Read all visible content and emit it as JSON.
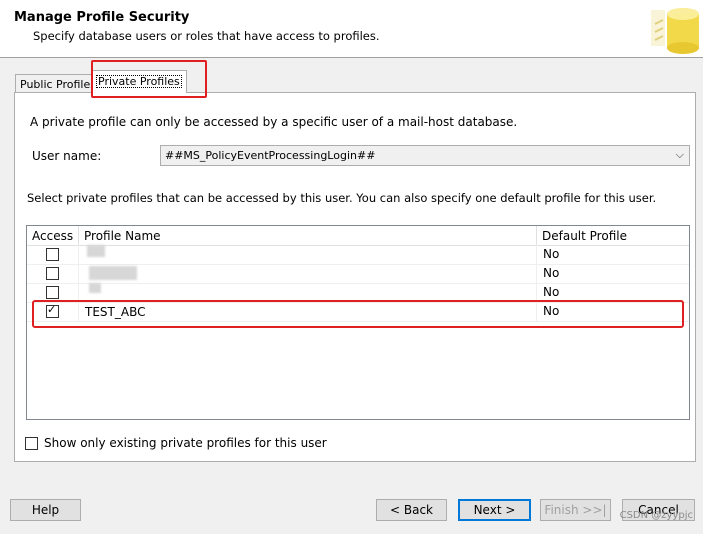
{
  "header": {
    "title": "Manage Profile Security",
    "subtitle": "Specify database users or roles that have access to profiles."
  },
  "tabs": [
    {
      "label": "Public Profiles",
      "selected": false
    },
    {
      "label": "Private Profiles",
      "selected": true
    }
  ],
  "panel": {
    "info_text": "A private profile can only be accessed by a specific user of a mail-host database.",
    "user_name_label": "User name:",
    "user_name_value": "##MS_PolicyEventProcessingLogin##",
    "select_text": "Select private profiles that can be accessed by this user. You can also specify one default profile for this user.",
    "grid": {
      "columns": [
        "Access",
        "Profile Name",
        "Default Profile"
      ],
      "rows": [
        {
          "access": false,
          "profile_name": "",
          "default_profile": "No"
        },
        {
          "access": false,
          "profile_name": "",
          "default_profile": "No"
        },
        {
          "access": false,
          "profile_name": "",
          "default_profile": "No"
        },
        {
          "access": true,
          "profile_name": "TEST_ABC",
          "default_profile": "No"
        }
      ]
    },
    "show_only_label": "Show only existing private profiles for this user",
    "show_only_checked": false
  },
  "buttons": {
    "help": "Help",
    "back": "< Back",
    "next": "Next >",
    "finish": "Finish >>|",
    "cancel": "Cancel"
  },
  "watermark": "CSDN @zyypjc",
  "colors": {
    "highlight": "#e02020",
    "accent": "#0078d7",
    "background": "#f0f0f0"
  }
}
